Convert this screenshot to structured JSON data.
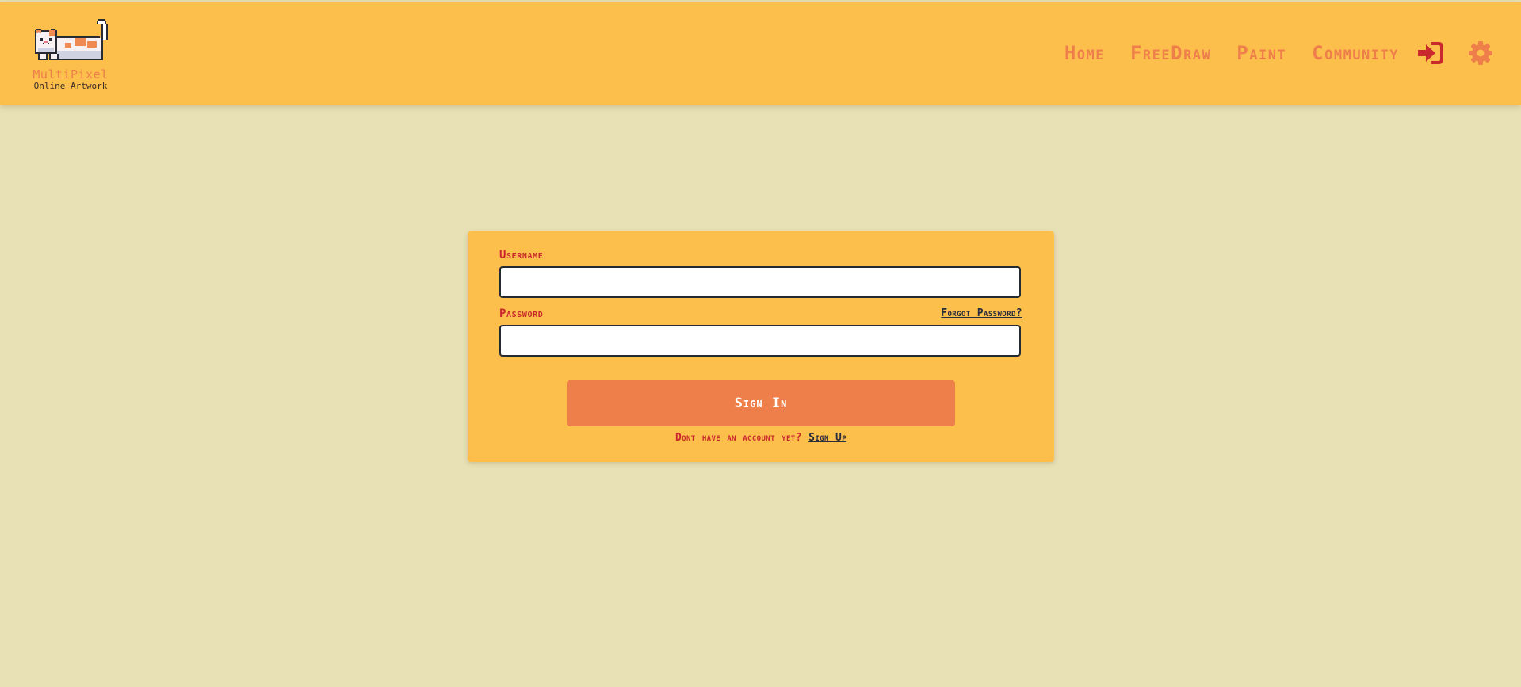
{
  "brand": {
    "title": "MultiPixel",
    "subtitle": "Online Artwork",
    "logo_icon": "pixel-cat-icon"
  },
  "nav": {
    "links": [
      {
        "label": "Home"
      },
      {
        "label": "FreeDraw"
      },
      {
        "label": "Paint"
      },
      {
        "label": "Community"
      }
    ],
    "login_icon": "sign-in-icon",
    "settings_icon": "gear-icon"
  },
  "login_form": {
    "username_label": "Username",
    "username_value": "",
    "password_label": "Password",
    "password_value": "",
    "forgot_password": "Forgot Password?",
    "submit_label": "Sign In",
    "signup_prompt": "Dont have an account yet?",
    "signup_link": "Sign Up"
  },
  "colors": {
    "page_background": "#e8e1b6",
    "navbar_background": "#fdbf4c",
    "accent": "#ee7f4b",
    "label_red": "#c9282d",
    "link_dark": "#2a2d3a"
  }
}
